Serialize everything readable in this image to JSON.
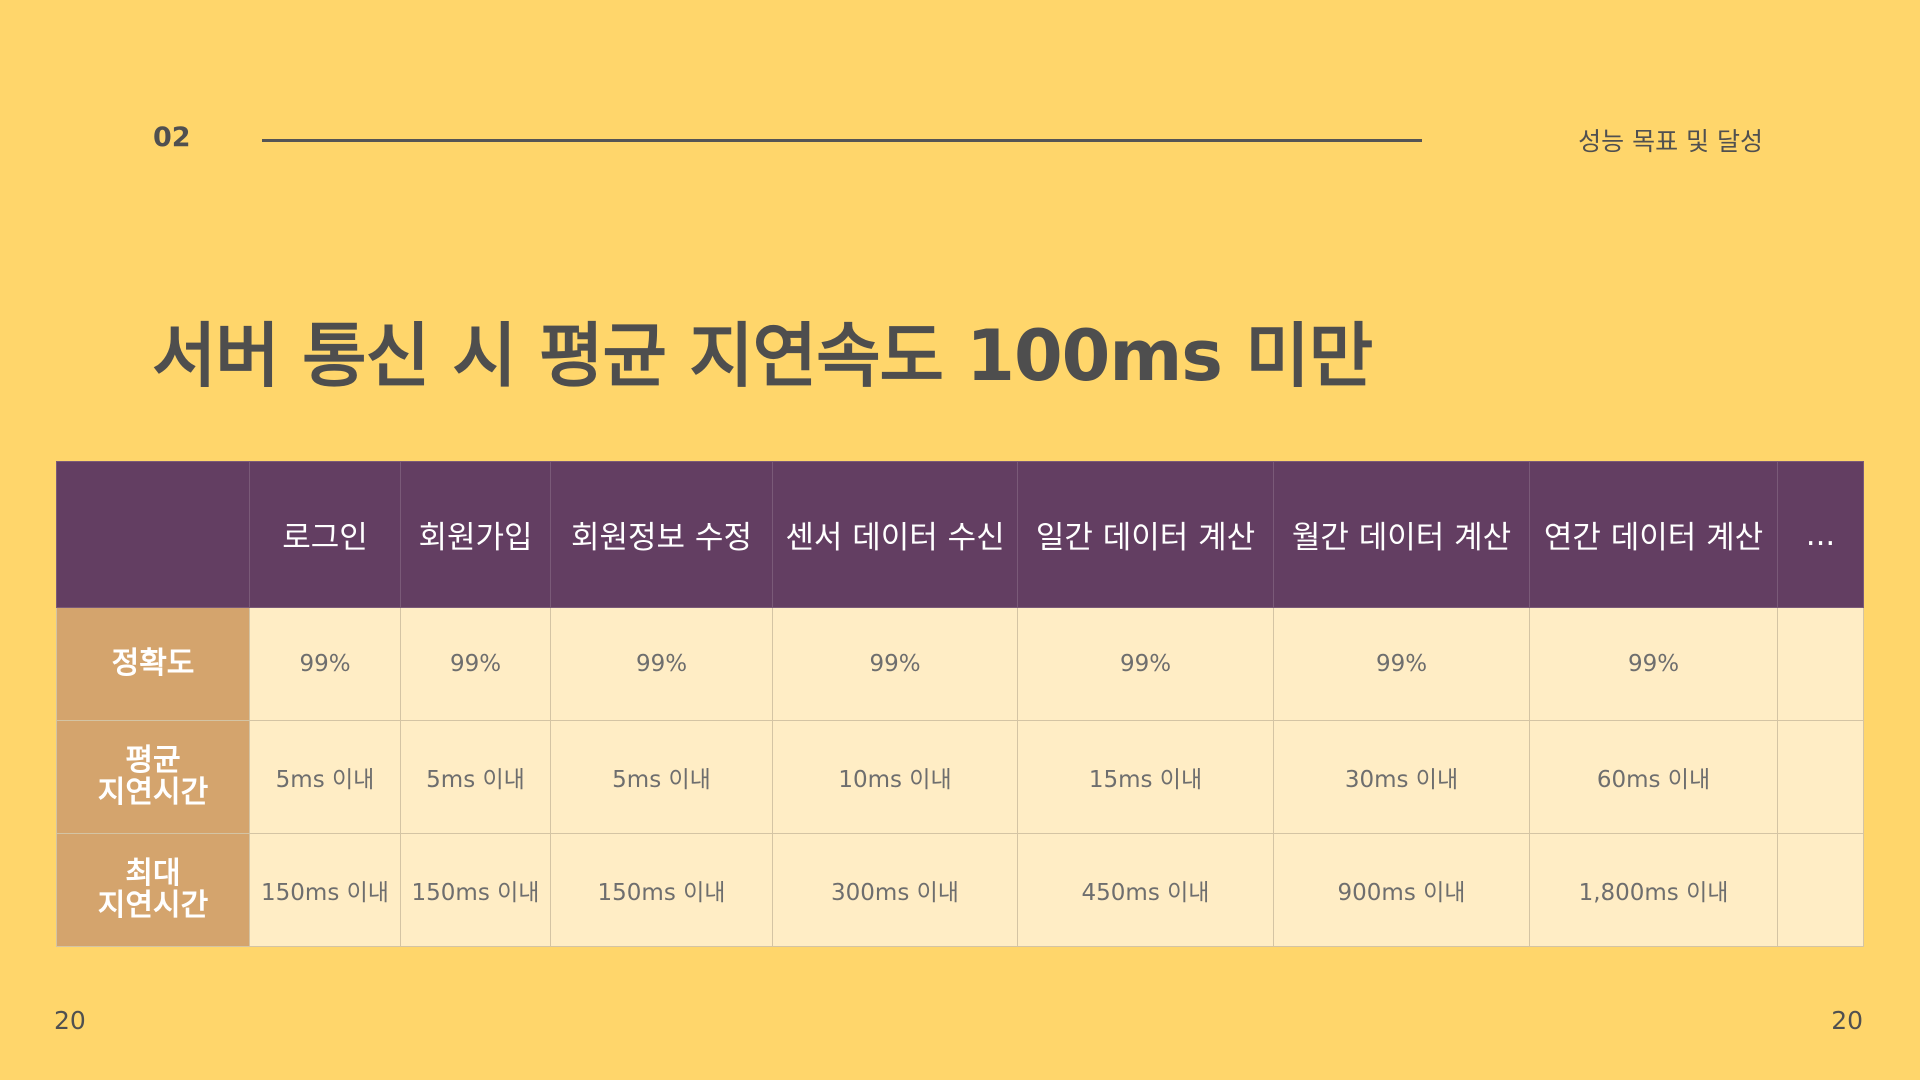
{
  "header": {
    "section_number": "02",
    "section_title": "성능 목표 및 달성"
  },
  "page_title": "서버 통신 시 평균 지연속도 100ms 미만",
  "table": {
    "corner": "",
    "columns": [
      "로그인",
      "회원가입",
      "회원정보 수정",
      "센서 데이터 수신",
      "일간 데이터 계산",
      "월간 데이터 계산",
      "연간 데이터 계산",
      "..."
    ],
    "rows": [
      {
        "label_lines": [
          "정확도"
        ],
        "cells": [
          "99%",
          "99%",
          "99%",
          "99%",
          "99%",
          "99%",
          "99%",
          ""
        ]
      },
      {
        "label_lines": [
          "평균",
          "지연시간"
        ],
        "cells": [
          "5ms 이내",
          "5ms 이내",
          "5ms 이내",
          "10ms 이내",
          "15ms 이내",
          "30ms 이내",
          "60ms 이내",
          ""
        ]
      },
      {
        "label_lines": [
          "최대",
          "지연시간"
        ],
        "cells": [
          "150ms 이내",
          "150ms 이내",
          "150ms 이내",
          "300ms 이내",
          "450ms 이내",
          "900ms 이내",
          "1,800ms 이내",
          ""
        ]
      }
    ]
  },
  "footer": {
    "page_left": "20",
    "page_right": "20"
  }
}
